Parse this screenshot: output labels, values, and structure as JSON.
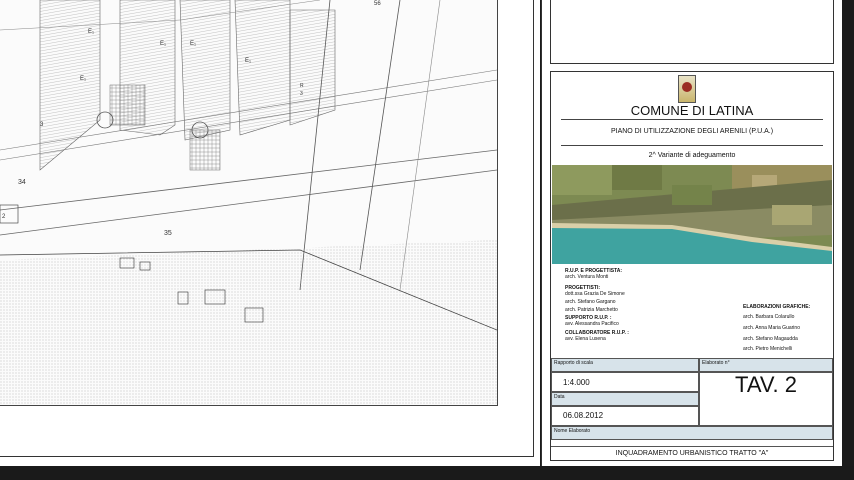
{
  "map": {
    "labels": [
      "56",
      "E₁",
      "E₁",
      "E₁",
      "E₁",
      "E₁",
      "3",
      "34",
      "35",
      "2",
      "R",
      "3"
    ]
  },
  "title_block": {
    "municipality": "COMUNE DI LATINA",
    "plan_title": "PIANO DI UTILIZZAZIONE DEGLI ARENILI  (P.U.A.)",
    "variant": "2^ Variante di adeguamento",
    "rup_heading": "R.U.P. E PROGETTISTA:",
    "rup_name": "arch. Ventura Monti",
    "designers_heading": "PROGETTISTI:",
    "designers": [
      "dott.ssa   Grazia De Simone",
      "arch. Stefano Gargano",
      "arch. Patrizia Marchetto"
    ],
    "support_heading": "SUPPORTO R.U.P. :",
    "support_name": "avv. Alessandra Pacifico",
    "collab_heading": "COLLABORATORE R.U.P. :",
    "collab_name": "avv. Elena Lusena",
    "graphics_heading": "ELABORAZIONI GRAFICHE:",
    "graphics": [
      "arch. Barbara Colarullo",
      "arch. Anna Maria Guarino",
      "arch. Stefano Magaudda",
      "arch. Pietro Menichelli"
    ],
    "scale_label": "Rapporto di scala",
    "scale_value": "1:4.000",
    "elaborato_label": "Elaborato n°",
    "date_label": "Data",
    "date_value": "06.08.2012",
    "sheet_number": "TAV. 2",
    "name_label": "Nome Elaborato",
    "sheet_name": "INQUADRAMENTO URBANISTICO TRATTO \"A\""
  }
}
